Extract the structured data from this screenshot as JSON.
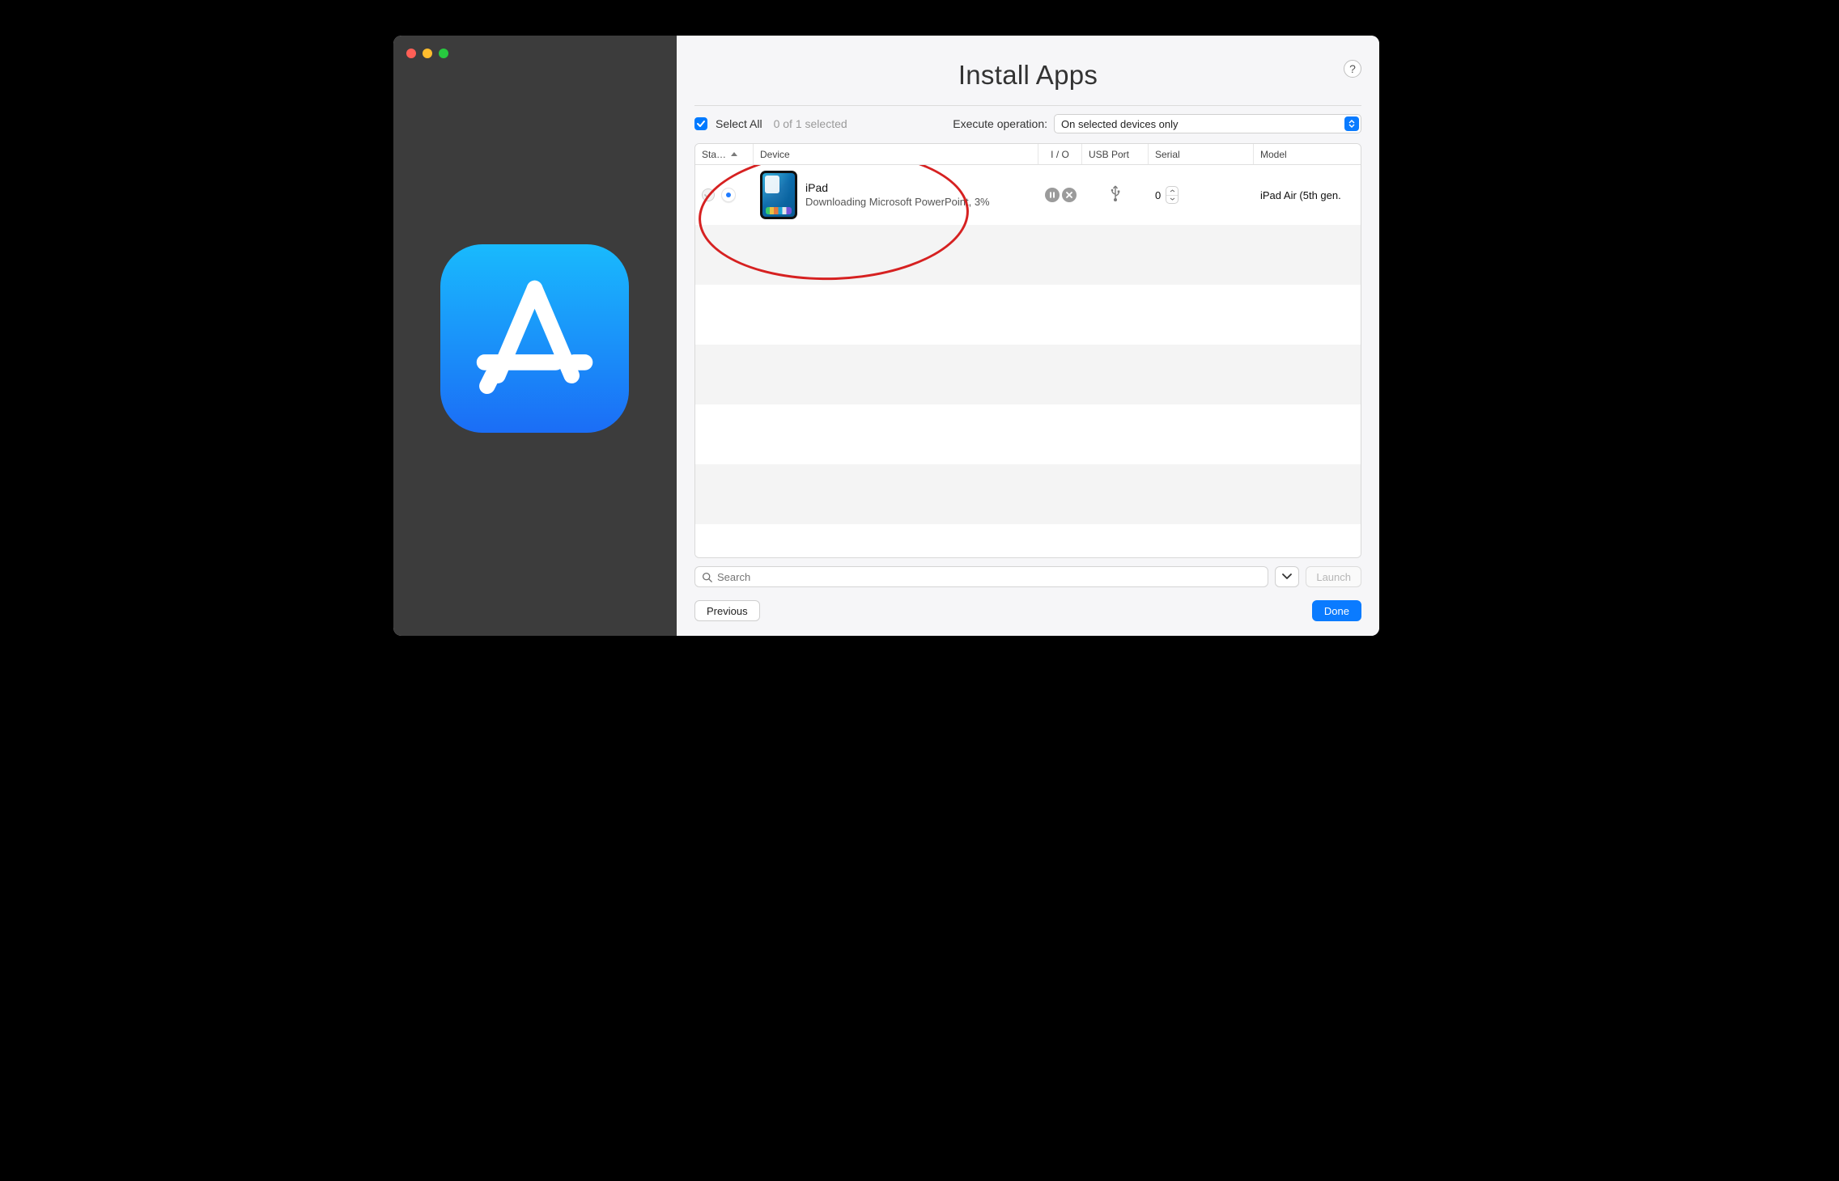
{
  "title": "Install Apps",
  "help_tooltip": "?",
  "toolbar": {
    "select_all_label": "Select All",
    "select_all_checked": true,
    "selection_count": "0 of 1 selected",
    "execute_label": "Execute operation:",
    "execute_value": "On selected devices only"
  },
  "columns": {
    "status": "Sta…",
    "device": "Device",
    "io": "I / O",
    "usb": "USB Port",
    "serial": "Serial",
    "model": "Model"
  },
  "rows": [
    {
      "checked": true,
      "busy": true,
      "device_name": "iPad",
      "device_status": "Downloading Microsoft PowerPoint, 3%",
      "io_icons": [
        "pause",
        "cancel"
      ],
      "usb_icon": "usb",
      "serial_value": "0",
      "model": "iPad Air (5th gen."
    }
  ],
  "search": {
    "placeholder": "Search",
    "value": ""
  },
  "buttons": {
    "launch": "Launch",
    "previous": "Previous",
    "done": "Done"
  },
  "sidebar": {
    "icon": "app-store"
  },
  "annotation": {
    "type": "red-ellipse",
    "targets": "device-row-0"
  }
}
